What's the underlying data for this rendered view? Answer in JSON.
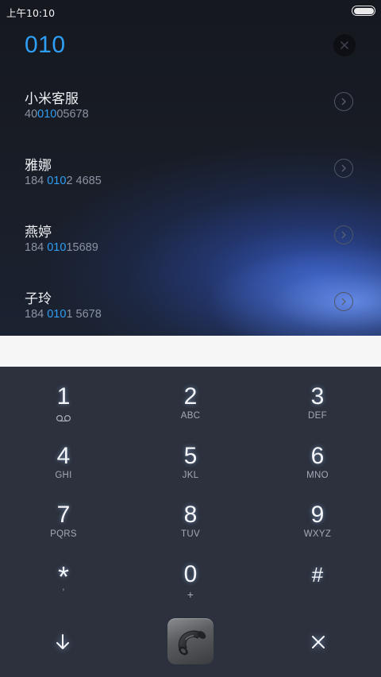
{
  "status_bar": {
    "time": "上午10:10"
  },
  "dialer": {
    "input_value": "010"
  },
  "results": [
    {
      "name": "小米客服",
      "number_before": "40",
      "number_match": "010",
      "number_after": "05678"
    },
    {
      "name": "雅娜",
      "number_before": "184 ",
      "number_match": "010",
      "number_after": "2 4685"
    },
    {
      "name": "燕婷",
      "number_before": "184 ",
      "number_match": "010",
      "number_after": "15689"
    },
    {
      "name": "子玲",
      "number_before": "184 ",
      "number_match": "010",
      "number_after": "1 5678"
    }
  ],
  "keypad": [
    {
      "digit": "1",
      "letters": "",
      "icon": "voicemail-icon"
    },
    {
      "digit": "2",
      "letters": "ABC"
    },
    {
      "digit": "3",
      "letters": "DEF"
    },
    {
      "digit": "4",
      "letters": "GHI"
    },
    {
      "digit": "5",
      "letters": "JKL"
    },
    {
      "digit": "6",
      "letters": "MNO"
    },
    {
      "digit": "7",
      "letters": "PQRS"
    },
    {
      "digit": "8",
      "letters": "TUV"
    },
    {
      "digit": "9",
      "letters": "WXYZ"
    },
    {
      "digit": "*",
      "letters": ","
    },
    {
      "digit": "0",
      "letters": "+"
    },
    {
      "digit": "#",
      "letters": ""
    }
  ],
  "colors": {
    "accent": "#2f9ef5",
    "keypad_bg": "#2c313d"
  }
}
